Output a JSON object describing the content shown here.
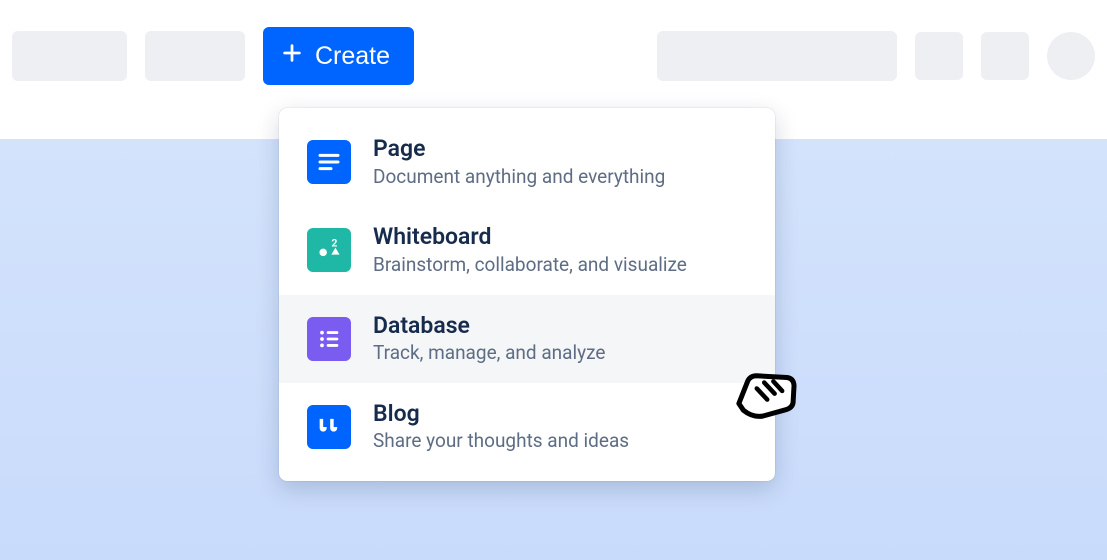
{
  "toolbar": {
    "create_label": "Create"
  },
  "menu": {
    "items": [
      {
        "title": "Page",
        "desc": "Document anything and everything"
      },
      {
        "title": "Whiteboard",
        "desc": "Brainstorm, collaborate, and visualize"
      },
      {
        "title": "Database",
        "desc": "Track, manage, and analyze"
      },
      {
        "title": "Blog",
        "desc": "Share your thoughts and ideas"
      }
    ]
  }
}
